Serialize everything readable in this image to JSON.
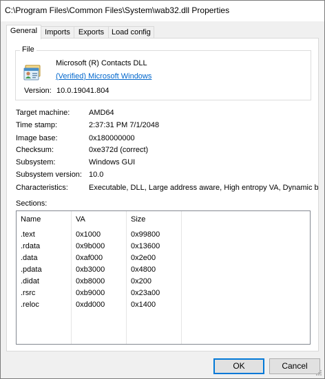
{
  "window": {
    "title": "C:\\Program Files\\Common Files\\System\\wab32.dll Properties"
  },
  "tabs": [
    {
      "label": "General",
      "active": true
    },
    {
      "label": "Imports",
      "active": false
    },
    {
      "label": "Exports",
      "active": false
    },
    {
      "label": "Load config",
      "active": false
    }
  ],
  "file": {
    "group_label": "File",
    "icon": "contacts-card-icon",
    "product": "Microsoft (R) Contacts DLL",
    "verified_link": "(Verified) Microsoft Windows",
    "version_label": "Version:",
    "version_value": "10.0.19041.804"
  },
  "properties": [
    {
      "label": "Target machine:",
      "value": "AMD64"
    },
    {
      "label": "Time stamp:",
      "value": "2:37:31 PM 7/1/2048"
    },
    {
      "label": "Image base:",
      "value": "0x180000000"
    },
    {
      "label": "Checksum:",
      "value": "0xe372d (correct)"
    },
    {
      "label": "Subsystem:",
      "value": "Windows GUI"
    },
    {
      "label": "Subsystem version:",
      "value": "10.0"
    },
    {
      "label": "Characteristics:",
      "value": "Executable, DLL, Large address aware, High entropy VA, Dynamic b"
    }
  ],
  "sections": {
    "label": "Sections:",
    "columns": [
      "Name",
      "VA",
      "Size"
    ],
    "rows": [
      [
        ".text",
        "0x1000",
        "0x99800"
      ],
      [
        ".rdata",
        "0x9b000",
        "0x13600"
      ],
      [
        ".data",
        "0xaf000",
        "0x2e00"
      ],
      [
        ".pdata",
        "0xb3000",
        "0x4800"
      ],
      [
        ".didat",
        "0xb8000",
        "0x200"
      ],
      [
        ".rsrc",
        "0xb9000",
        "0x23a00"
      ],
      [
        ".reloc",
        "0xdd000",
        "0x1400"
      ]
    ]
  },
  "buttons": {
    "ok": "OK",
    "cancel": "Cancel"
  },
  "colors": {
    "link": "#0066cc",
    "default_button_border": "#0078d7",
    "dialog_background": "#f0f0f0"
  }
}
